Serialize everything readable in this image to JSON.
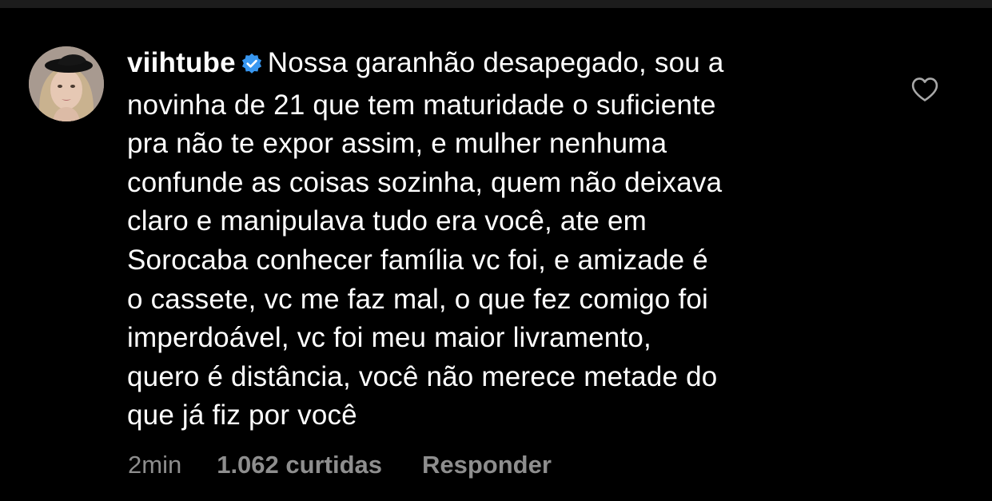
{
  "comment": {
    "username": "viihtube",
    "verified_icon": "verified-badge-icon",
    "lines": [
      "Nossa garanhão desapegado, sou a",
      "novinha de 21 que tem maturidade o suficiente",
      "pra não te expor assim, e mulher nenhuma",
      "confunde as coisas sozinha, quem não deixava",
      "claro e manipulava tudo era você, ate em",
      "Sorocaba conhecer família vc foi, e amizade é",
      "o cassete, vc me faz mal, o que fez comigo foi",
      "imperdoável, vc foi meu maior livramento,",
      "quero é distância, você não merece metade do",
      "que já fiz por você"
    ],
    "time": "2min",
    "likes": "1.062 curtidas",
    "reply_label": "Responder",
    "like_icon": "heart-outline-icon"
  },
  "colors": {
    "background": "#000000",
    "text": "#ffffff",
    "secondary_text": "#8e8e8e",
    "verified_blue": "#3897f0"
  }
}
